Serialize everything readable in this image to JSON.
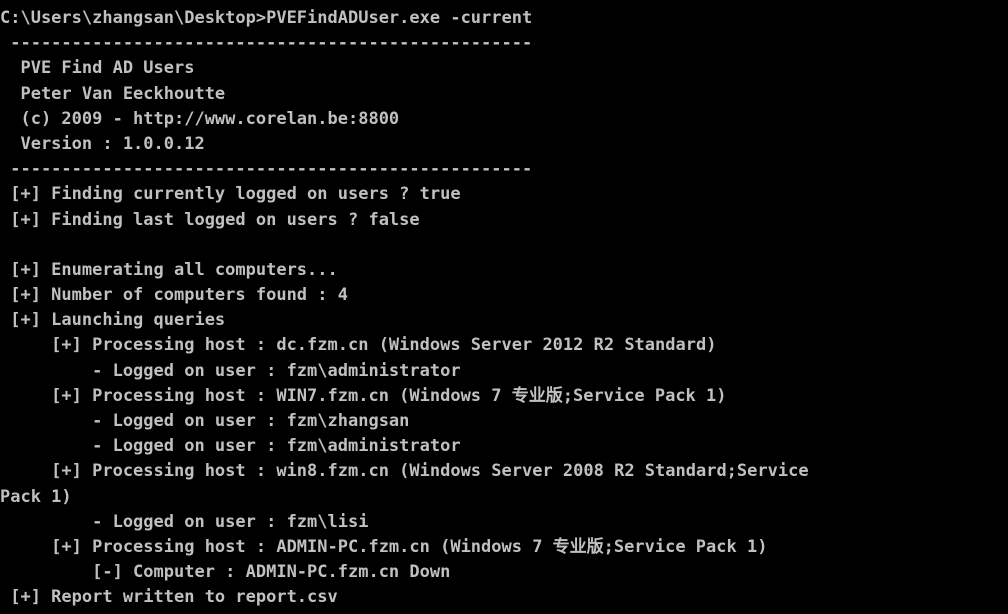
{
  "console": {
    "lines": [
      "C:\\Users\\zhangsan\\Desktop>PVEFindADUser.exe -current",
      " ---------------------------------------------------",
      "  PVE Find AD Users",
      "  Peter Van Eeckhoutte",
      "  (c) 2009 - http://www.corelan.be:8800",
      "  Version : 1.0.0.12",
      " ---------------------------------------------------",
      " [+] Finding currently logged on users ? true",
      " [+] Finding last logged on users ? false",
      "",
      " [+] Enumerating all computers...",
      " [+] Number of computers found : 4",
      " [+] Launching queries",
      "     [+] Processing host : dc.fzm.cn (Windows Server 2012 R2 Standard)",
      "         - Logged on user : fzm\\administrator",
      "     [+] Processing host : WIN7.fzm.cn (Windows 7 专业版;Service Pack 1)",
      "         - Logged on user : fzm\\zhangsan",
      "         - Logged on user : fzm\\administrator",
      "     [+] Processing host : win8.fzm.cn (Windows Server 2008 R2 Standard;Service",
      "Pack 1)",
      "         - Logged on user : fzm\\lisi",
      "     [+] Processing host : ADMIN-PC.fzm.cn (Windows 7 专业版;Service Pack 1)",
      "         [-] Computer : ADMIN-PC.fzm.cn Down",
      " [+] Report written to report.csv"
    ]
  }
}
